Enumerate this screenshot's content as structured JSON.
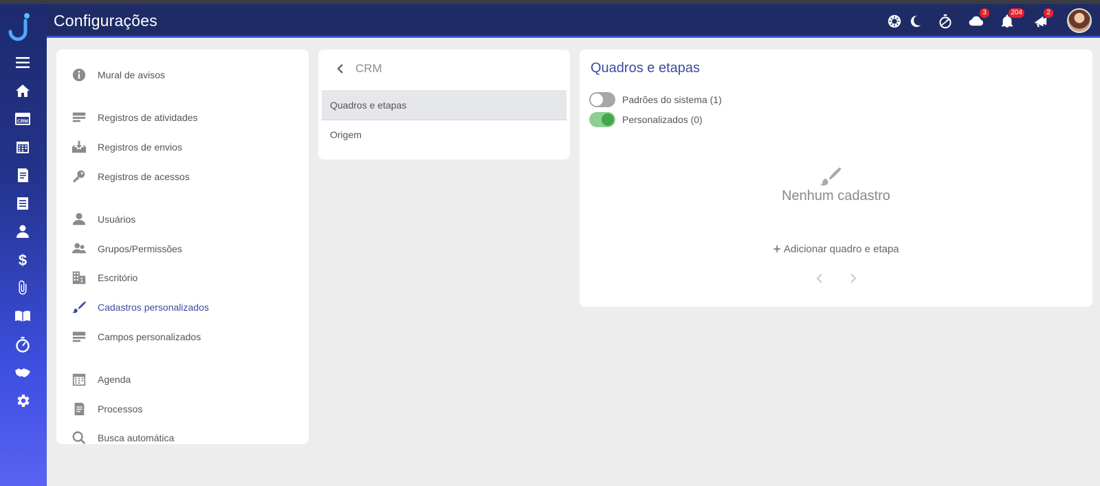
{
  "header": {
    "title": "Configurações",
    "badges": {
      "cloud": "3",
      "bell": "204",
      "announce": "2"
    }
  },
  "menu": {
    "items": [
      {
        "label": "Mural de avisos",
        "icon": "info-icon"
      },
      {
        "label": "Registros de atividades",
        "icon": "list-icon"
      },
      {
        "label": "Registros de envios",
        "icon": "inbox-download-icon"
      },
      {
        "label": "Registros de acessos",
        "icon": "key-icon"
      },
      {
        "label": "Usuários",
        "icon": "user-icon"
      },
      {
        "label": "Grupos/Permissões",
        "icon": "users-group-icon"
      },
      {
        "label": "Escritório",
        "icon": "building-icon"
      },
      {
        "label": "Cadastros personalizados",
        "icon": "brush-icon",
        "active": true
      },
      {
        "label": "Campos personalizados",
        "icon": "fields-icon"
      },
      {
        "label": "Agenda",
        "icon": "calendar-icon"
      },
      {
        "label": "Processos",
        "icon": "process-doc-icon"
      },
      {
        "label": "Busca automática",
        "icon": "search-icon"
      }
    ]
  },
  "submenu": {
    "back_label": "CRM",
    "items": [
      {
        "label": "Quadros e etapas",
        "selected": true
      },
      {
        "label": "Origem"
      }
    ]
  },
  "main": {
    "title": "Quadros e etapas",
    "toggles": [
      {
        "label": "Padrões do sistema (1)",
        "on": false
      },
      {
        "label": "Personalizados (0)",
        "on": true
      }
    ],
    "empty_text": "Nenhum cadastro",
    "add_label": "Adicionar quadro e etapa"
  },
  "colors": {
    "header_bg": "#1f2b65",
    "accent": "#3b4c9e",
    "toggle_on": "#43a847",
    "badge": "#e8212b"
  }
}
